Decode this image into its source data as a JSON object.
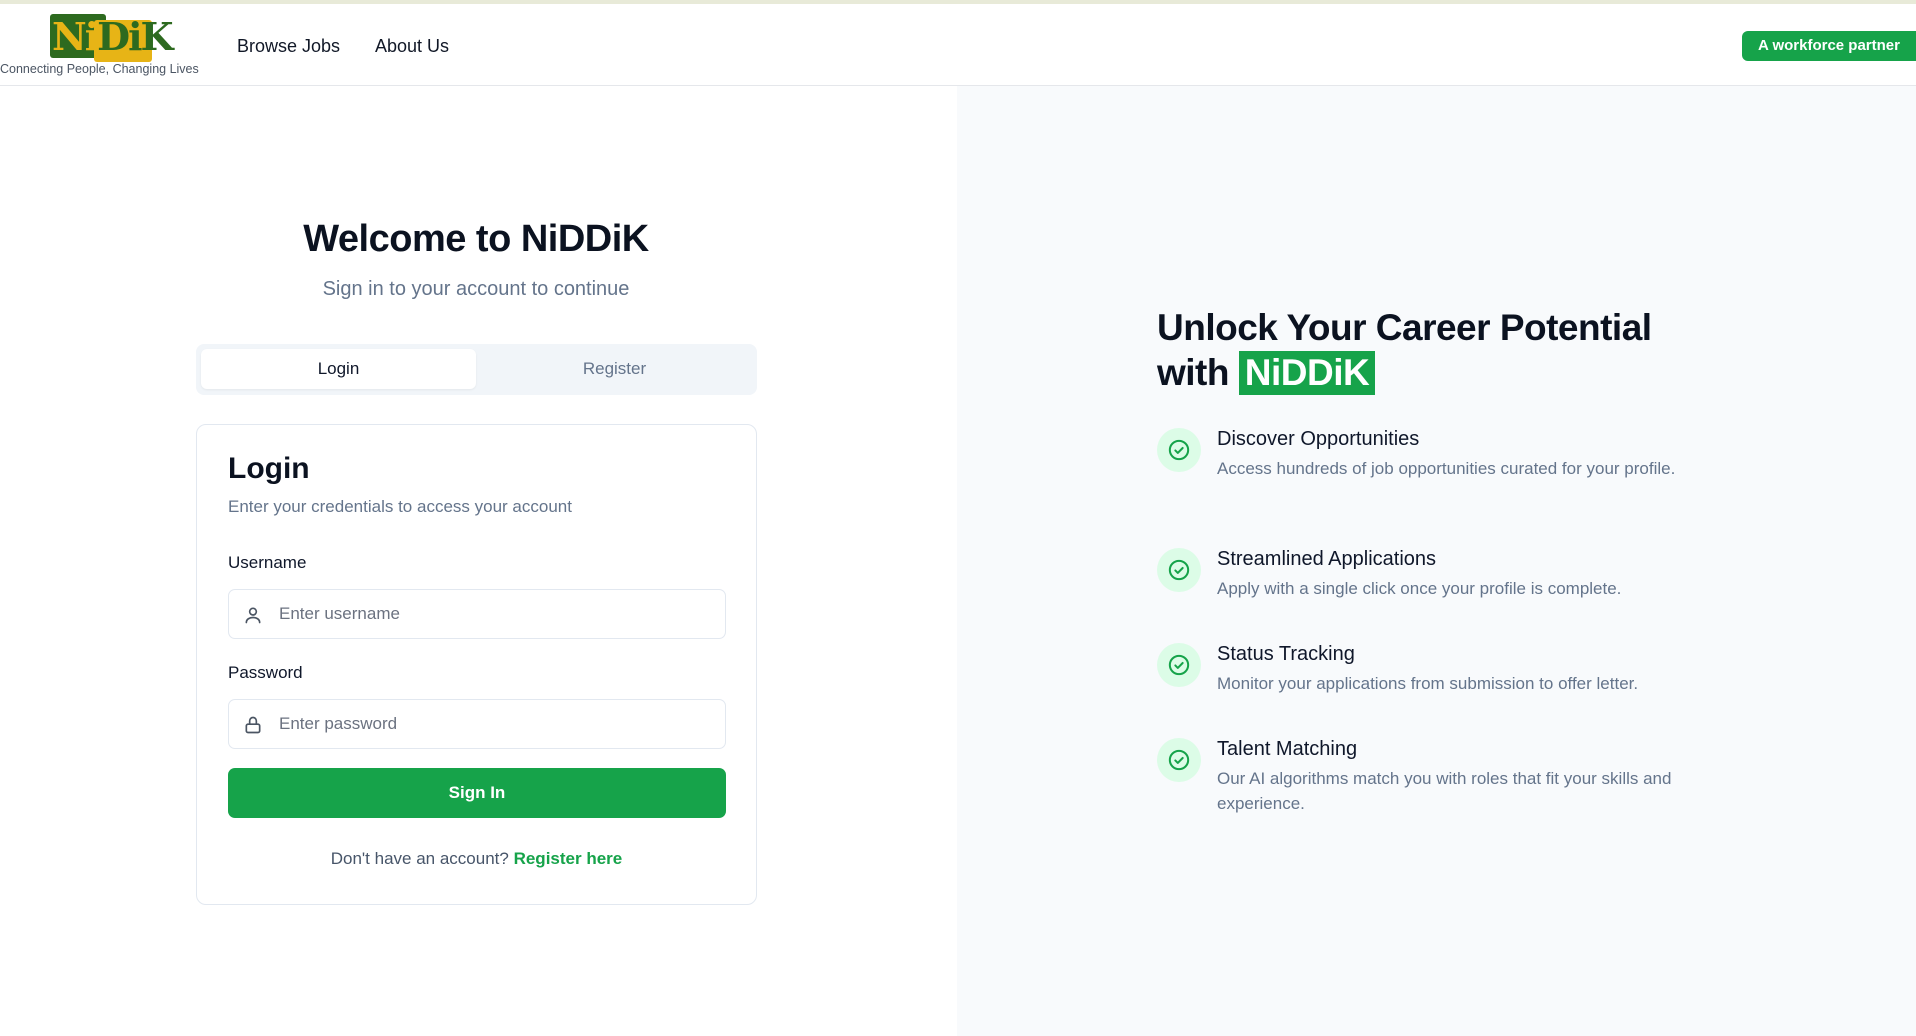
{
  "header": {
    "logo_text_a": "Ni",
    "logo_text_b": "DiK",
    "tagline": "Connecting People, Changing Lives",
    "nav": [
      {
        "label": "Browse Jobs"
      },
      {
        "label": "About Us"
      }
    ],
    "partner_badge": "A workforce partner"
  },
  "welcome": {
    "title": "Welcome to NiDDiK",
    "subtitle": "Sign in to your account to continue"
  },
  "tabs": [
    {
      "label": "Login",
      "active": true
    },
    {
      "label": "Register",
      "active": false
    }
  ],
  "login_card": {
    "title": "Login",
    "description": "Enter your credentials to access your account",
    "username_label": "Username",
    "username_placeholder": "Enter username",
    "username_value": "",
    "password_label": "Password",
    "password_placeholder": "Enter password",
    "password_value": "",
    "submit_label": "Sign In",
    "register_prompt": "Don't have an account?",
    "register_link": "Register here"
  },
  "hero": {
    "title_line1": "Unlock Your Career Potential",
    "title_with": "with",
    "brand": "NiDDiK",
    "features": [
      {
        "title": "Discover Opportunities",
        "description": "Access hundreds of job opportunities curated for your profile."
      },
      {
        "title": "Streamlined Applications",
        "description": "Apply with a single click once your profile is complete."
      },
      {
        "title": "Status Tracking",
        "description": "Monitor your applications from submission to offer letter."
      },
      {
        "title": "Talent Matching",
        "description": "Our AI algorithms match you with roles that fit your skills and experience."
      }
    ]
  },
  "colors": {
    "brand_green": "#16a34a",
    "logo_dark_green": "#2d6a1f",
    "logo_yellow": "#e7b416",
    "check_bg": "#dcfce7",
    "panel_bg": "#f8fafc"
  },
  "icons": {
    "username": "user-icon",
    "password": "lock-icon",
    "feature": "check-circle-icon"
  }
}
